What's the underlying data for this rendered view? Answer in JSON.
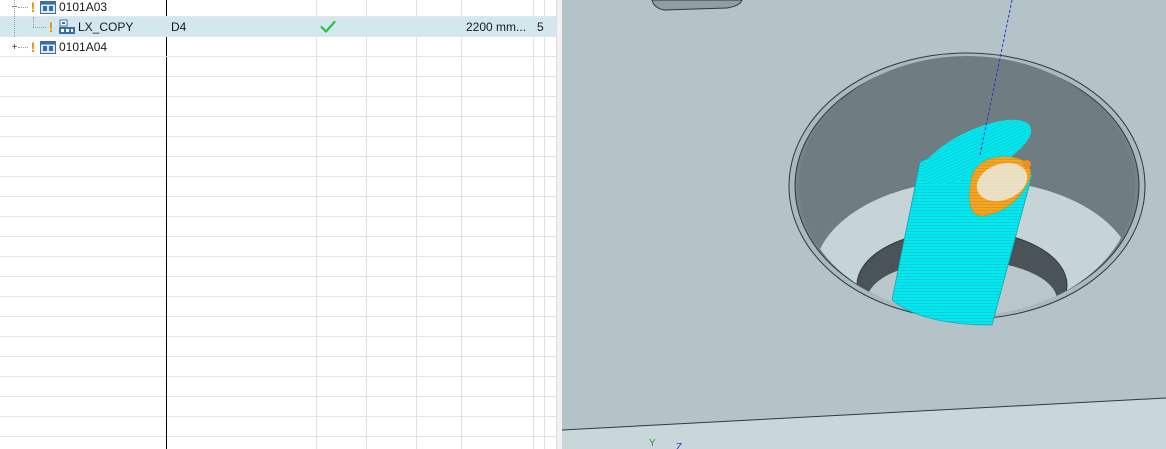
{
  "navigator": {
    "rows": [
      {
        "name": "0101A03",
        "expander": "−",
        "type": "program-group"
      },
      {
        "name": "LX_COPY",
        "tool": "D4",
        "status_icon": "check-icon",
        "length": "2200 mm...",
        "extra": "5",
        "type": "operation"
      },
      {
        "name": "0101A04",
        "expander": "+",
        "type": "program-group"
      }
    ],
    "warning_glyph": "!"
  },
  "viewport": {
    "triad": {
      "y_label": "Y",
      "z_label": "Z"
    }
  },
  "colors": {
    "selected_row": "#d3e8ee",
    "check": "#2fbf3f",
    "warning": "#f08c00",
    "model_face": "#b3c3c8",
    "toolpath": "#00f0f0",
    "toolpath_top": "#f5a623",
    "tool_axis": "#2a35d6"
  }
}
